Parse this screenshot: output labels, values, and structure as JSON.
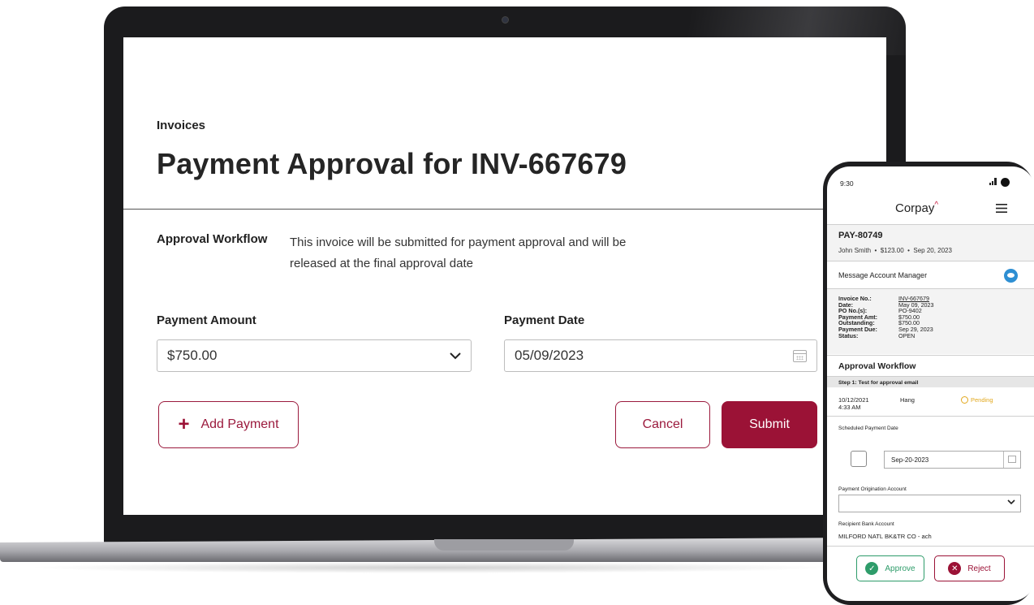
{
  "app": {
    "breadcrumb": "Invoices",
    "title": "Payment Approval for INV-667679",
    "workflow_label": "Approval Workflow",
    "workflow_text": "This invoice will be submitted for payment approval and will be released at the final approval date",
    "payment_amount_label": "Payment Amount",
    "payment_amount_value": "$750.00",
    "payment_date_label": "Payment Date",
    "payment_date_value": "05/09/2023",
    "add_payment_label": "Add Payment",
    "cancel_label": "Cancel",
    "submit_label": "Submit",
    "accent_color": "#9b1236"
  },
  "phone": {
    "time": "9:30",
    "brand": "Corpay",
    "payment_id": "PAY-80749",
    "meta": [
      "John Smith",
      "$123.00",
      "Sep 20, 2023"
    ],
    "message_label": "Message Account Manager",
    "details": [
      {
        "key": "Invoice No.:",
        "value": "INV-667679"
      },
      {
        "key": "Date:",
        "value": "May 09, 2023"
      },
      {
        "key": "PO No.(s):",
        "value": "PO-9402"
      },
      {
        "key": "Payment Amt:",
        "value": "$750.00"
      },
      {
        "key": "Outstanding:",
        "value": "$750.00"
      },
      {
        "key": "Payment Due:",
        "value": "Sep 29, 2023"
      },
      {
        "key": "Status:",
        "value": "OPEN"
      }
    ],
    "workflow_title": "Approval Workflow",
    "step_label": "Step 1: Test for approval email",
    "step_date": "10/12/2021",
    "step_time": "4:33 AM",
    "step_user": "Hang",
    "step_status": "Pending",
    "scheduled_label": "Scheduled Payment Date",
    "scheduled_value": "Sep-20-2023",
    "origin_label": "Payment Origination Account",
    "recipient_label": "Recipient Bank Account",
    "recipient_value": "MILFORD NATL BK&TR CO - ach",
    "approve_label": "Approve",
    "reject_label": "Reject",
    "approve_color": "#2e9c6a",
    "pending_color": "#e2a81d"
  }
}
